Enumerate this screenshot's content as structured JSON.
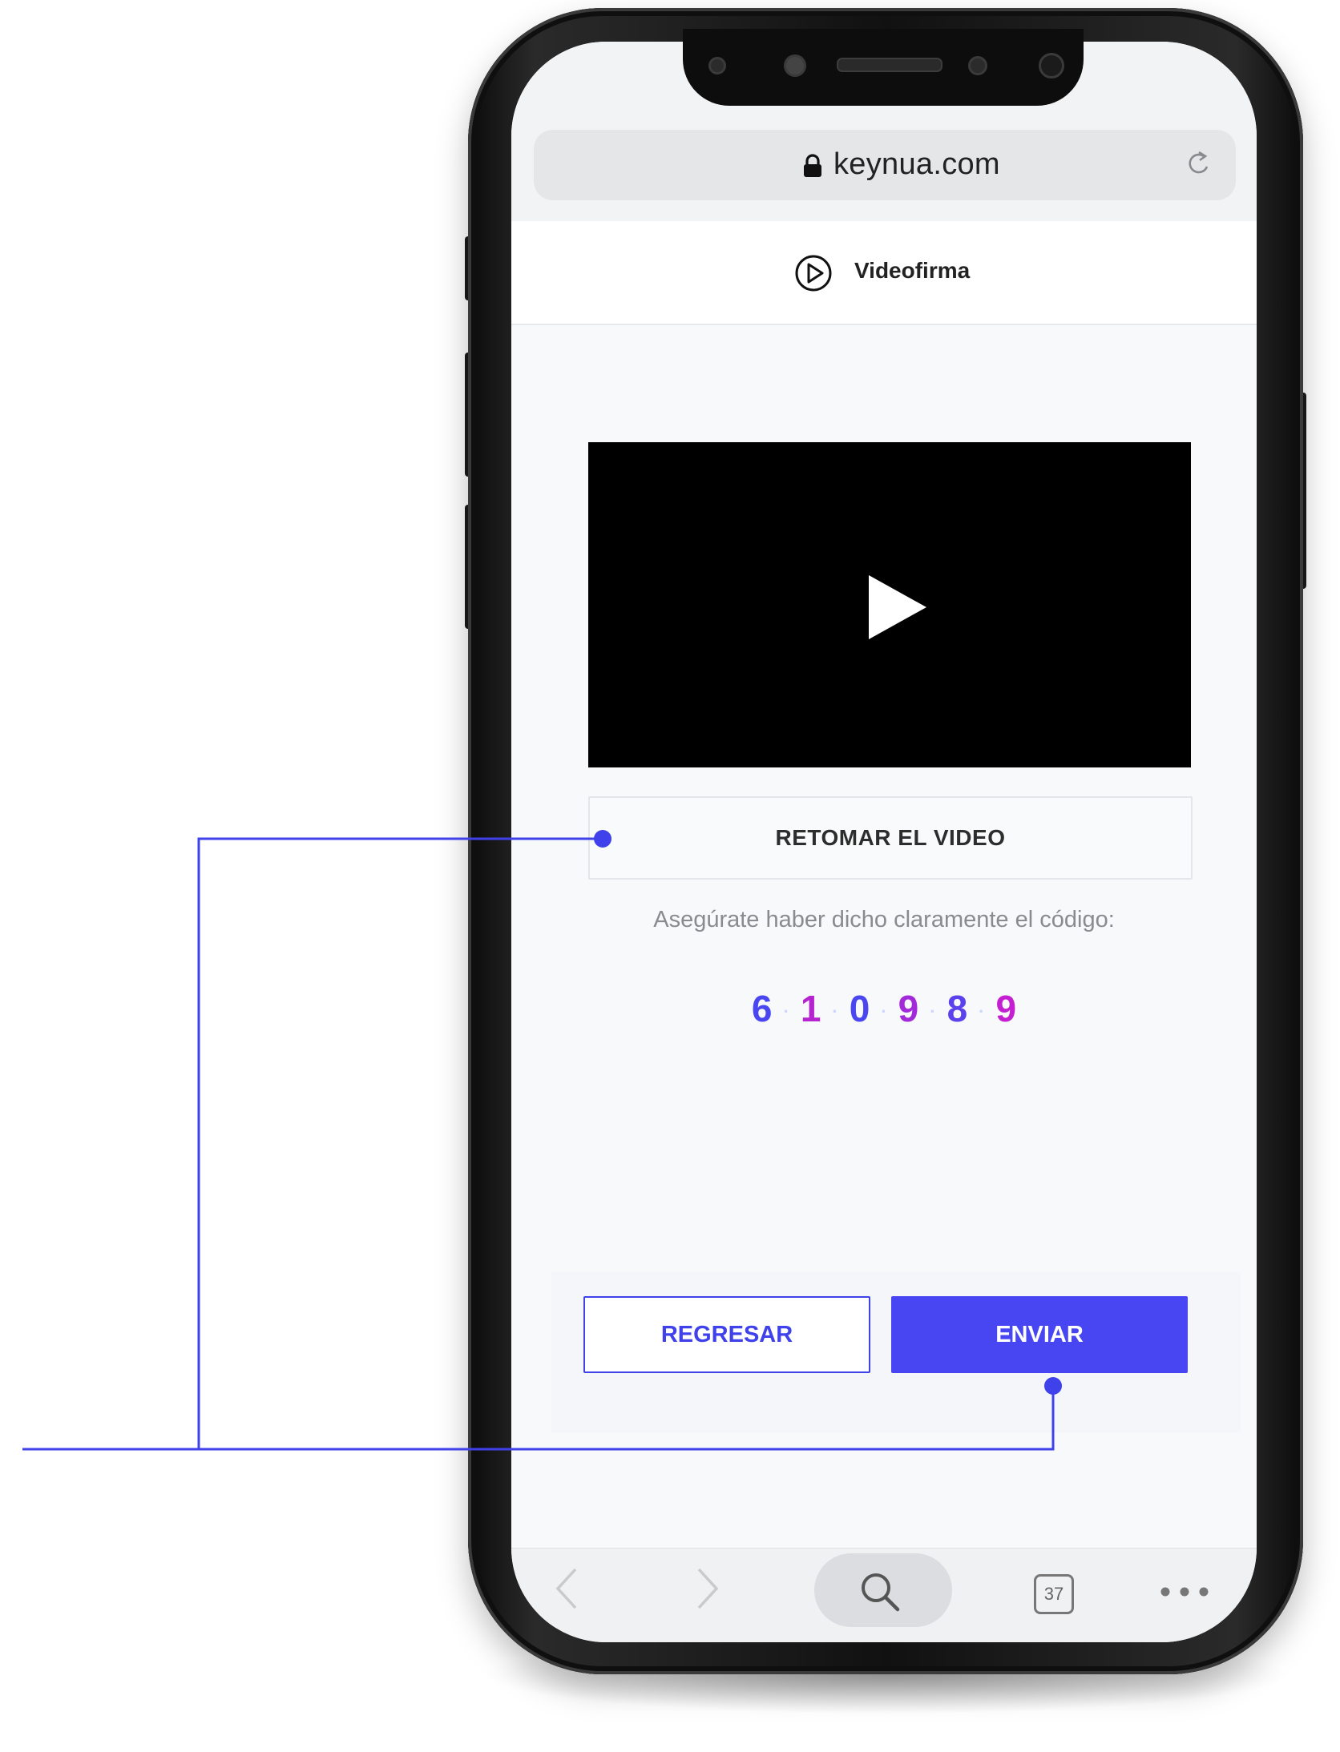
{
  "browser": {
    "url": "keynua.com",
    "tab_count": "37",
    "lock_icon": "lock-icon",
    "reload_icon": "reload-icon",
    "toolbar_icons": [
      "chevron-left-icon",
      "chevron-right-icon",
      "search-icon",
      "tabs-icon",
      "more-icon"
    ]
  },
  "header": {
    "title": "Videofirma",
    "icon": "play-circle-icon"
  },
  "video": {
    "icon": "play-icon"
  },
  "actions": {
    "retake_label": "RETOMAR EL VIDEO",
    "back_label": "REGRESAR",
    "send_label": "ENVIAR"
  },
  "verification": {
    "hint": "Asegúrate haber dicho claramente el código:",
    "digits": [
      "6",
      "1",
      "0",
      "9",
      "8",
      "9"
    ],
    "separator": "·"
  },
  "colors": {
    "accent": "#4845f3",
    "annotation_line": "#3f42ea",
    "digit_gradient": [
      "#4a47f0",
      "#a22ad8",
      "#c41fd0"
    ]
  }
}
